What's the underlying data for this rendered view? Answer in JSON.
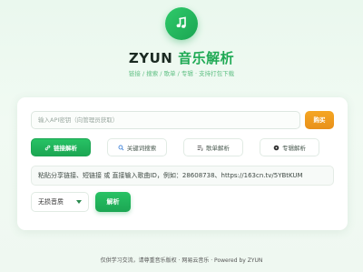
{
  "header": {
    "logo_icon": "music-note-icon",
    "title_brand": "ZYUN",
    "title_suffix": "音乐解析",
    "tagline": "链接 / 搜索 / 歌单 / 专辑 · 支持打包下载"
  },
  "api": {
    "placeholder": "输入API密钥（向管理员获取）",
    "buy_label": "购买"
  },
  "tabs": [
    {
      "label": "链接解析",
      "icon": "link-icon",
      "active": true
    },
    {
      "label": "关键词搜索",
      "icon": "search-icon",
      "active": false
    },
    {
      "label": "歌单解析",
      "icon": "playlist-icon",
      "active": false
    },
    {
      "label": "专辑解析",
      "icon": "album-disc-icon",
      "active": false
    }
  ],
  "link_input": {
    "placeholder": "粘贴分享链接、短链接 或 直接输入歌曲ID，例如：28608738、https://163cn.tv/5YBtKUM"
  },
  "quality": {
    "selected": "无损音质"
  },
  "parse_button": "解析",
  "footer": "仅供学习交流，请尊重音乐版权 · 网易云音乐 · Powered by ZYUN",
  "colors": {
    "accent": "#1ea954",
    "buy": "#f5a623",
    "background": "#eaf8ee"
  }
}
